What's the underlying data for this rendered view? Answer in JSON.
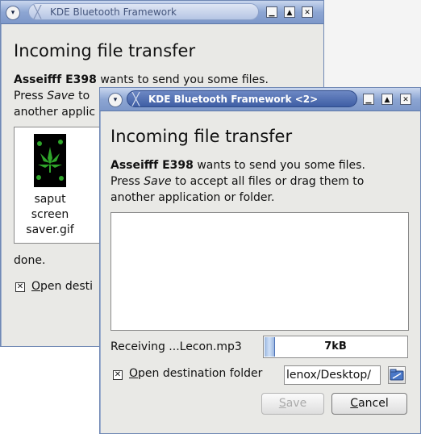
{
  "windows": [
    {
      "title": "KDE Bluetooth Framework",
      "active": false,
      "heading": "Incoming file transfer",
      "device": "Asseifff E398",
      "message_rest": " wants to send you some files.",
      "press_line_start": "Press ",
      "press_line_save": "Save",
      "press_line_rest": " to",
      "line3": "another applic",
      "file": {
        "name_lines": [
          "saput",
          "screen",
          "saver.gif"
        ],
        "icon": "cannabis-leaf-thumbnail"
      },
      "status": "done.",
      "open_dest_label_first": "O",
      "open_dest_label_rest": "pen desti",
      "open_dest_checked": true
    },
    {
      "title": "KDE Bluetooth Framework <2>",
      "active": true,
      "heading": "Incoming file transfer",
      "device": "Asseifff E398",
      "message_rest": " wants to send you some files.",
      "press_line_start": "Press ",
      "press_line_save": "Save",
      "press_line_rest": " to accept all files or drag them to",
      "line3": "another application or folder.",
      "receiving_label": "Receiving ...Lecon.mp3",
      "progress_text": "7kB",
      "progress_fraction": 0.07,
      "open_dest_label_first": "O",
      "open_dest_label_rest": "pen destination folder",
      "open_dest_checked": true,
      "dest_path": "lenox/Desktop/",
      "save_button_first": "S",
      "save_button_rest": "ave",
      "save_enabled": false,
      "cancel_button_first": "C",
      "cancel_button_rest": "ancel"
    }
  ],
  "glyphs": {
    "check": "✕",
    "menu": "▾",
    "minimize": "▁",
    "maximize": "▲",
    "close": "✕",
    "kde": "╳"
  },
  "colors": {
    "titlebar_active": "#3f5fa5",
    "accent": "#4d73b8"
  }
}
